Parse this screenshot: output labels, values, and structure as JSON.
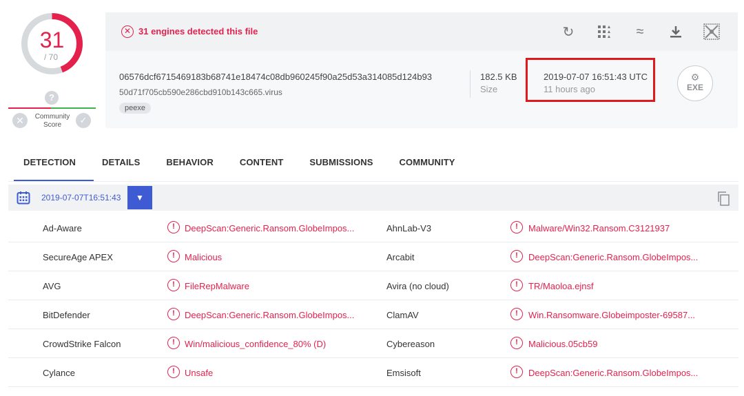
{
  "score": {
    "detected": "31",
    "total": "/ 70",
    "ring_color": "#e4214d"
  },
  "community": {
    "question_glyph": "?",
    "label_line1": "Community",
    "label_line2": "Score",
    "bad_glyph": "✕",
    "good_glyph": "✓"
  },
  "header": {
    "detection_text": "31 engines detected this file",
    "detection_icon": "x-circle-icon",
    "actions": [
      {
        "name": "reanalyze-icon",
        "glyph": "↻"
      },
      {
        "name": "graph-icon",
        "glyph": "⋮⋮"
      },
      {
        "name": "similar-icon",
        "glyph": "≈"
      },
      {
        "name": "download-icon",
        "glyph": "⤓"
      },
      {
        "name": "graph-view-icon",
        "glyph": "⊠"
      }
    ],
    "hash": "06576dcf6715469183b68741e18474c08db960245f90a25d53a314085d124b93",
    "filename": "50d71f705cb590e286cbd910b143c665.virus",
    "tag": "peexe",
    "size_value": "182.5 KB",
    "size_label": "Size",
    "date_value": "2019-07-07 16:51:43 UTC",
    "date_relative": "11 hours ago",
    "file_type": "EXE",
    "file_type_glyph": "⚙"
  },
  "tabs": [
    "DETECTION",
    "DETAILS",
    "BEHAVIOR",
    "CONTENT",
    "SUBMISSIONS",
    "COMMUNITY"
  ],
  "active_tab": "DETECTION",
  "datebar": {
    "date": "2019-07-07T16:51:43",
    "dropdown_glyph": "▼"
  },
  "detections": [
    {
      "engine_left": "Ad-Aware",
      "result_left": "DeepScan:Generic.Ransom.GlobeImpos...",
      "engine_right": "AhnLab-V3",
      "result_right": "Malware/Win32.Ransom.C3121937"
    },
    {
      "engine_left": "SecureAge APEX",
      "result_left": "Malicious",
      "engine_right": "Arcabit",
      "result_right": "DeepScan:Generic.Ransom.GlobeImpos..."
    },
    {
      "engine_left": "AVG",
      "result_left": "FileRepMalware",
      "engine_right": "Avira (no cloud)",
      "result_right": "TR/Maoloa.ejnsf"
    },
    {
      "engine_left": "BitDefender",
      "result_left": "DeepScan:Generic.Ransom.GlobeImpos...",
      "engine_right": "ClamAV",
      "result_right": "Win.Ransomware.Globeimposter-69587..."
    },
    {
      "engine_left": "CrowdStrike Falcon",
      "result_left": "Win/malicious_confidence_80% (D)",
      "engine_right": "Cybereason",
      "result_right": "Malicious.05cb59"
    },
    {
      "engine_left": "Cylance",
      "result_left": "Unsafe",
      "engine_right": "Emsisoft",
      "result_right": "DeepScan:Generic.Ransom.GlobeImpos..."
    }
  ],
  "alert_glyph": "!"
}
